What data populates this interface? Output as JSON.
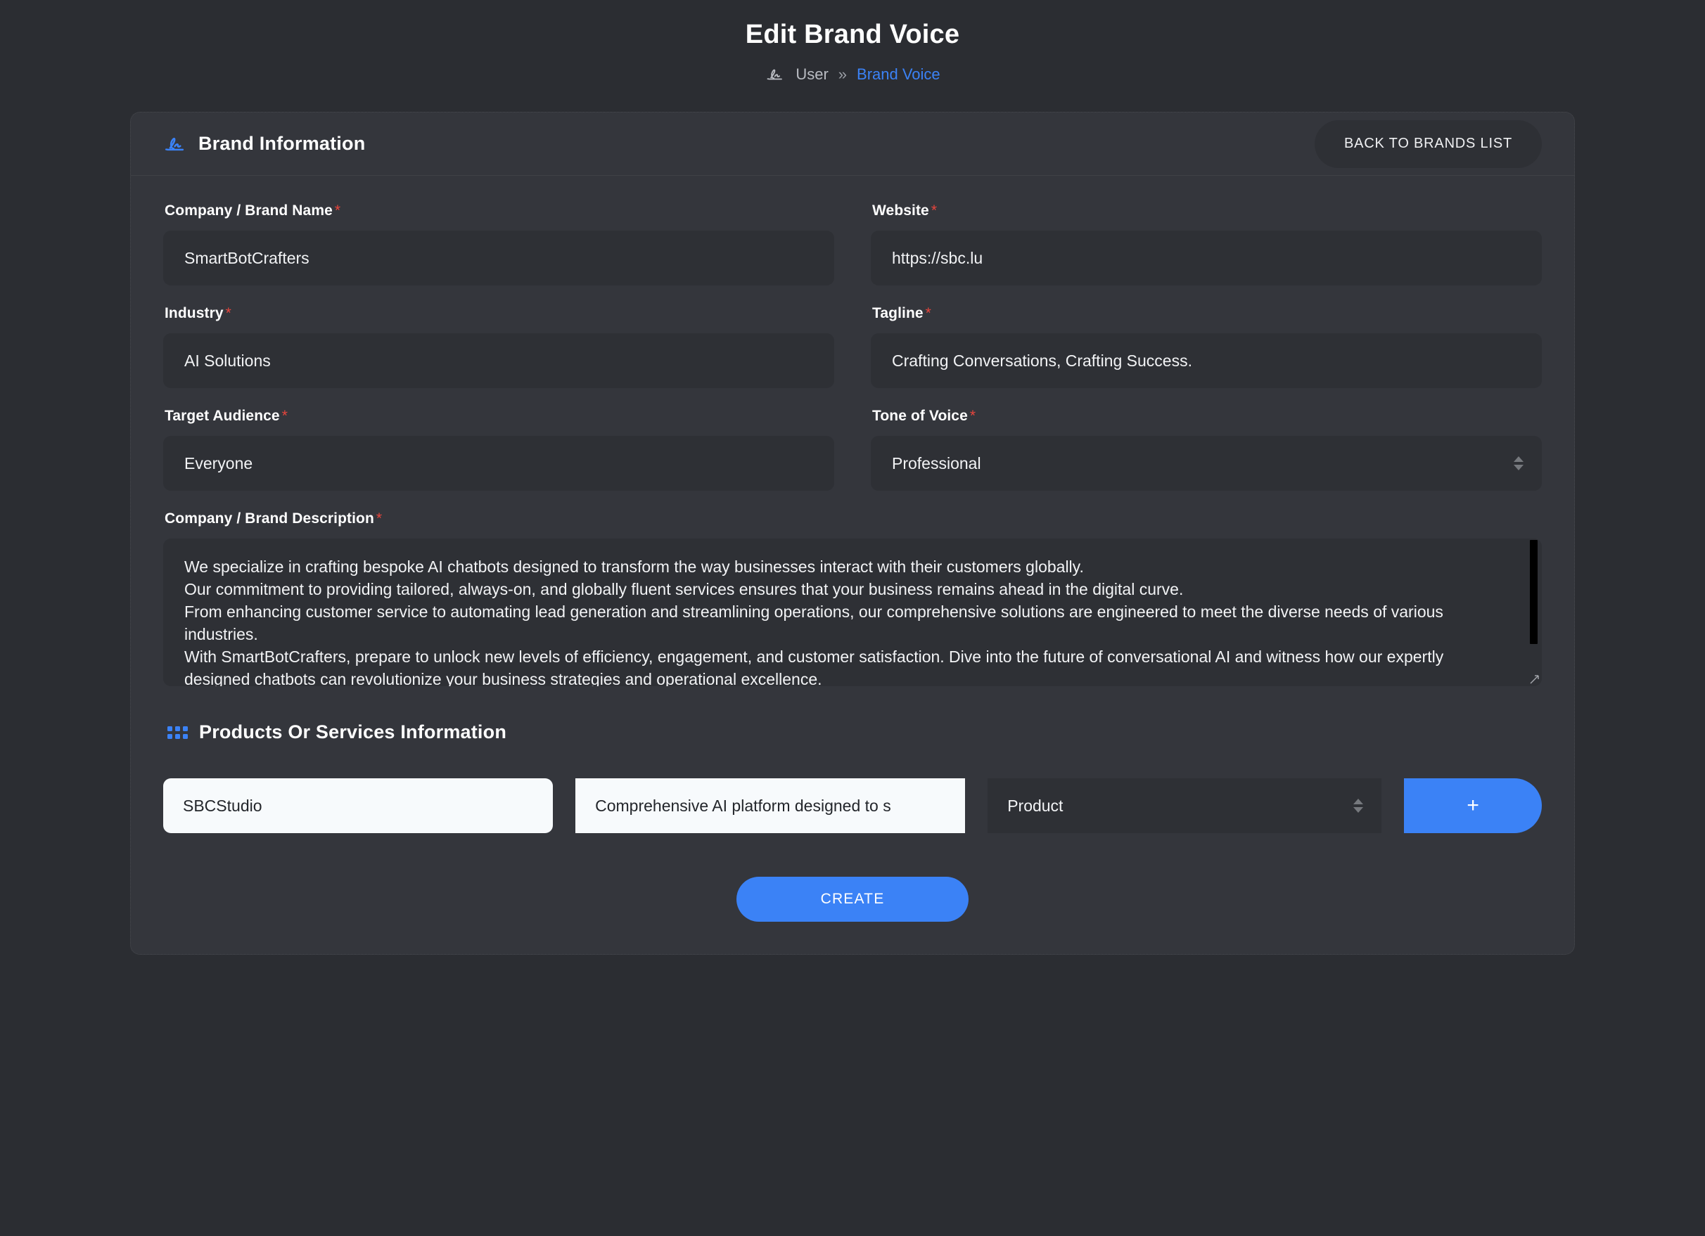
{
  "header": {
    "title": "Edit Brand Voice",
    "breadcrumb": {
      "icon": "signature-icon",
      "parent": "User",
      "separator": "»",
      "current": "Brand Voice"
    }
  },
  "card": {
    "icon": "signature-icon",
    "title": "Brand Information",
    "back_button": "BACK TO BRANDS LIST"
  },
  "form": {
    "company_name": {
      "label": "Company / Brand Name",
      "required": "*",
      "value": "SmartBotCrafters"
    },
    "website": {
      "label": "Website",
      "required": "*",
      "value": "https://sbc.lu"
    },
    "industry": {
      "label": "Industry",
      "required": "*",
      "value": "AI Solutions"
    },
    "tagline": {
      "label": "Tagline",
      "required": "*",
      "value": "Crafting Conversations, Crafting Success."
    },
    "target_audience": {
      "label": "Target Audience",
      "required": "*",
      "value": "Everyone"
    },
    "tone_of_voice": {
      "label": "Tone of Voice",
      "required": "*",
      "value": "Professional",
      "control": "select"
    },
    "description": {
      "label": "Company / Brand Description",
      "required": "*",
      "value": "We specialize in crafting bespoke AI chatbots designed to transform the way businesses interact with their customers globally.\nOur commitment to providing tailored, always-on, and globally fluent services ensures that your business remains ahead in the digital curve.\nFrom enhancing customer service to automating lead generation and streamlining operations, our comprehensive solutions are engineered to meet the diverse needs of various industries.\nWith SmartBotCrafters, prepare to unlock new levels of efficiency, engagement, and customer satisfaction. Dive into the future of conversational AI and witness how our expertly designed chatbots can revolutionize your business strategies and operational excellence."
    }
  },
  "products": {
    "icon": "grid-dots-icon",
    "title": "Products Or Services Information",
    "rows": [
      {
        "name": "SBCStudio",
        "description": "Comprehensive AI platform designed to s",
        "type": "Product"
      }
    ],
    "add_button": "+"
  },
  "footer": {
    "submit_label": "CREATE"
  },
  "colors": {
    "page_bg": "#2b2d32",
    "card_bg": "#34363c",
    "input_bg": "#2e3035",
    "accent": "#3b82f6",
    "required": "#e8453c",
    "text": "#ffffff"
  }
}
